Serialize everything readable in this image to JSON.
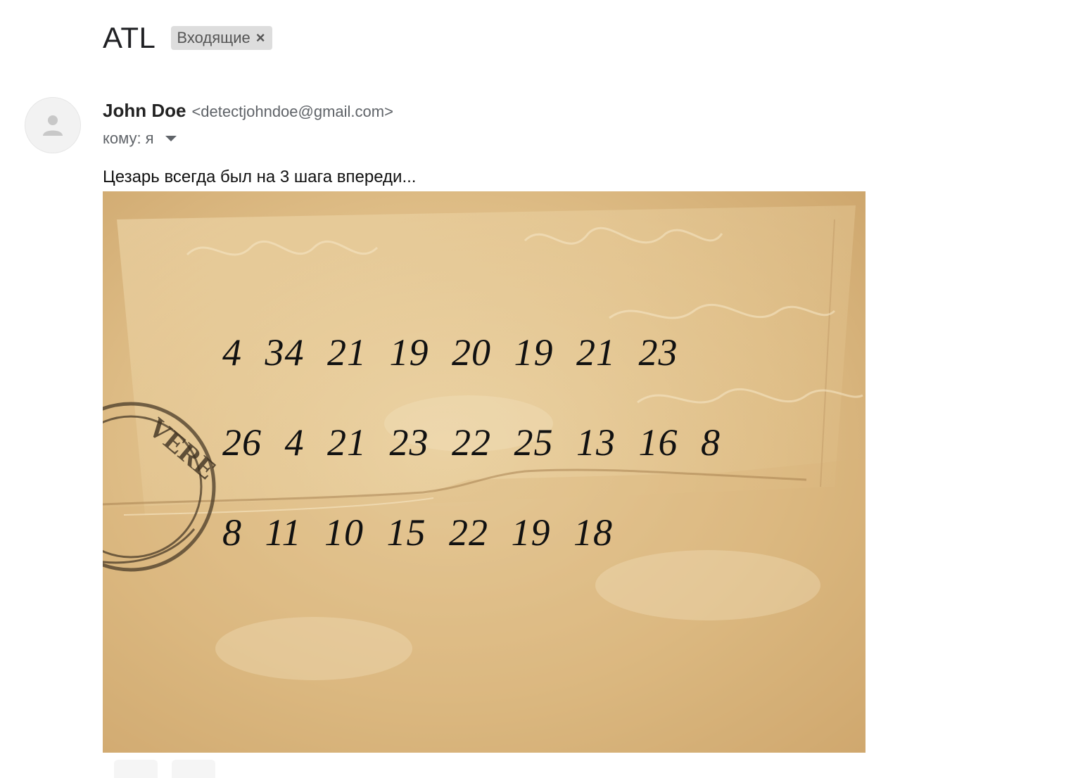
{
  "email": {
    "subject": "ATL",
    "label": "Входящие",
    "label_remove": "×",
    "sender": {
      "name": "John Doe",
      "email": "<detectjohndoe@gmail.com>"
    },
    "recipient": {
      "prefix": "кому:",
      "value": "я"
    },
    "body": "Цезарь всегда был на 3 шага впереди...",
    "attachment": {
      "cipher_lines": [
        "4 34 21 19 20 19 21 23",
        "26 4 21 23 22 25 13 16 8",
        "8 11 10 15 22 19 18"
      ],
      "stamp_text": "VERE"
    }
  },
  "colors": {
    "paper_light": "#e9cf9c",
    "paper_mid": "#d8b47a",
    "paper_dark": "#c49a5c",
    "chip_bg": "#dddddd"
  }
}
